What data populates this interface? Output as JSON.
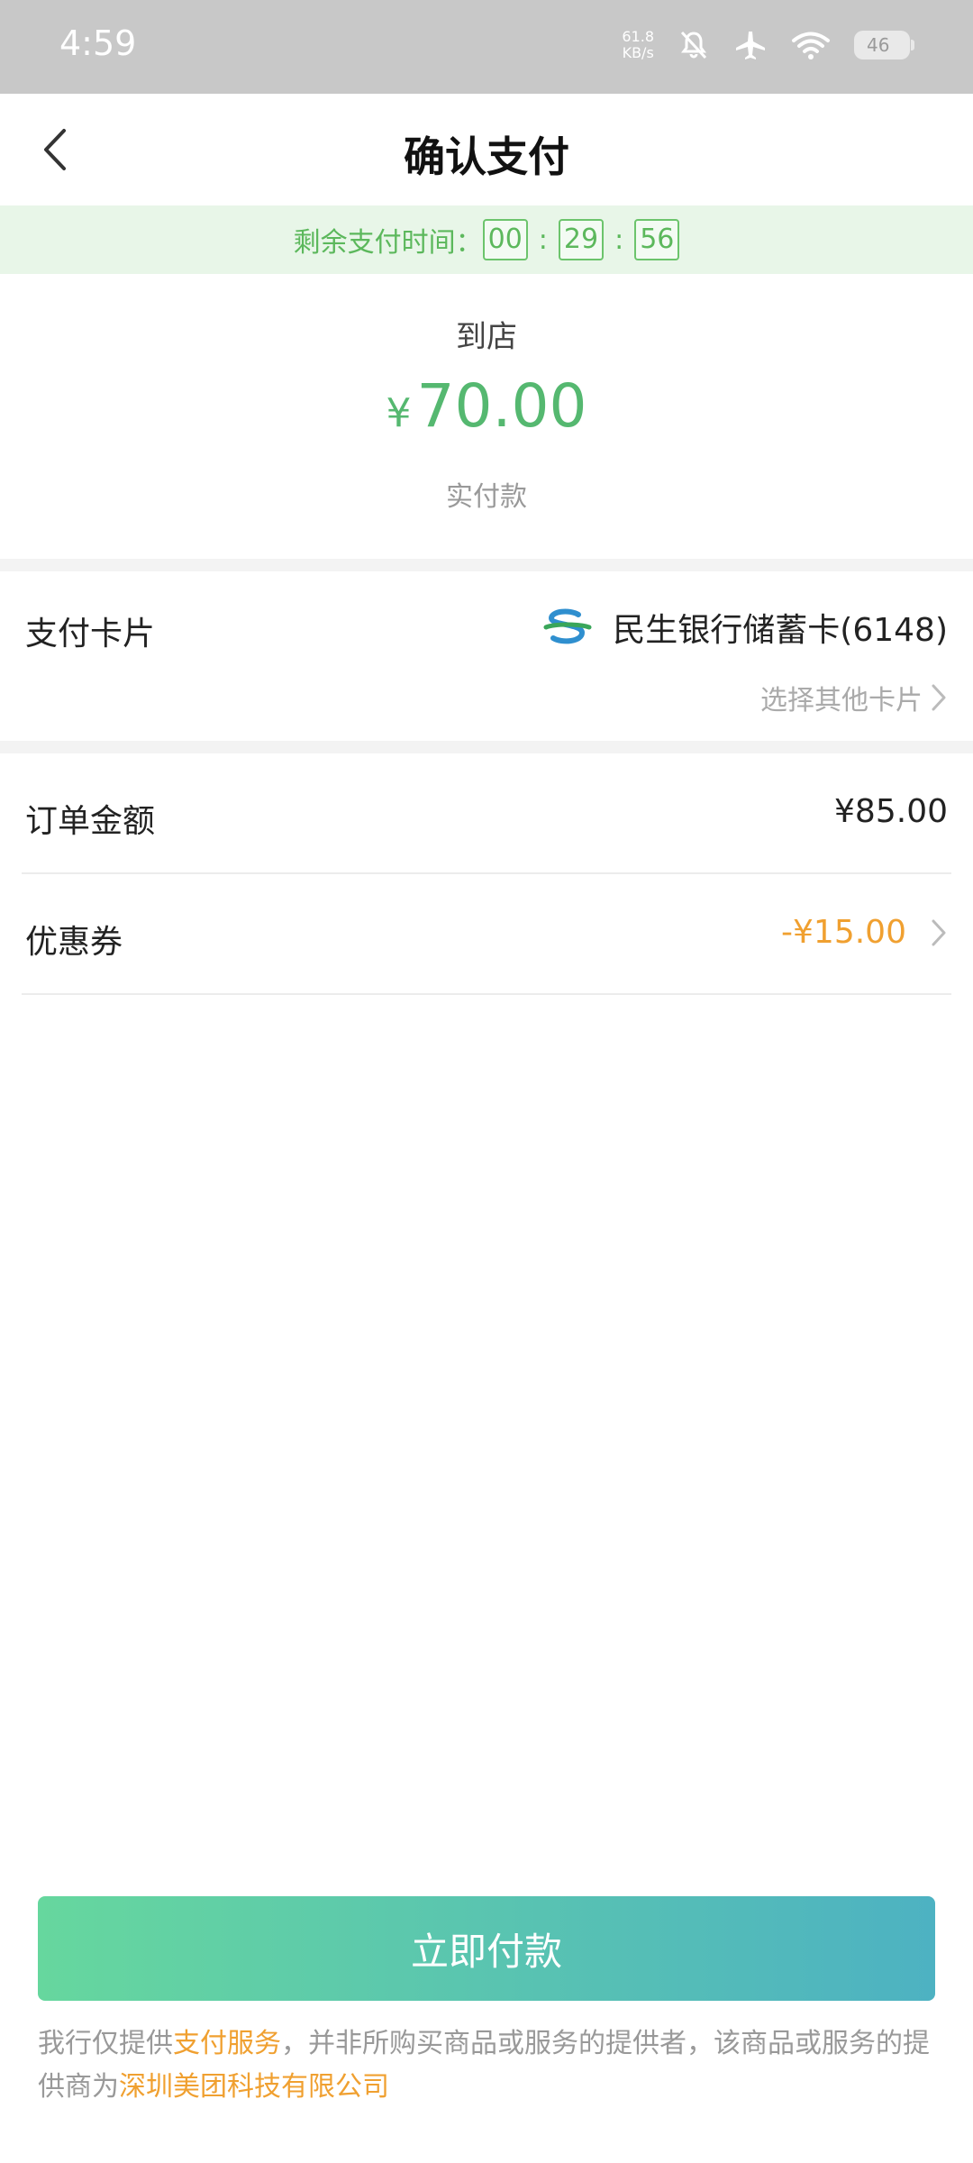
{
  "status_bar": {
    "time": "4:59",
    "net_speed_value": "61.8",
    "net_speed_unit": "KB/s",
    "battery": "46",
    "icons": [
      "bell-muted-icon",
      "airplane-icon",
      "wifi-icon",
      "battery-icon"
    ]
  },
  "header": {
    "title": "确认支付",
    "back_icon": "chevron-left-icon"
  },
  "timer": {
    "label": "剩余支付时间：",
    "hours": "00",
    "minutes": "29",
    "seconds": "56",
    "separator": ":"
  },
  "payment": {
    "merchant": "到店",
    "currency": "¥",
    "amount": "70.00",
    "amount_label": "实付款"
  },
  "card": {
    "label": "支付卡片",
    "bank_name": "民生银行储蓄卡(6148)",
    "bank_icon": "cmbc-bank-logo",
    "other_cards": "选择其他卡片"
  },
  "order": {
    "amount_label": "订单金额",
    "amount_value": "¥85.00",
    "coupon_label": "优惠券",
    "coupon_value": "-¥15.00"
  },
  "actions": {
    "pay_now": "立即付款"
  },
  "disclaimer": {
    "part1": "我行仅提供",
    "highlight1": "支付服务",
    "part2": "，并非所购买商品或服务的提供者，该商品或服务的提供商为",
    "highlight2": "深圳美团科技有限公司"
  },
  "colors": {
    "accent_green": "#55b870",
    "coupon_orange": "#f0a030",
    "button_gradient_start": "#66d79e",
    "button_gradient_end": "#4db2c2",
    "timer_bg": "#e8f6e8"
  }
}
